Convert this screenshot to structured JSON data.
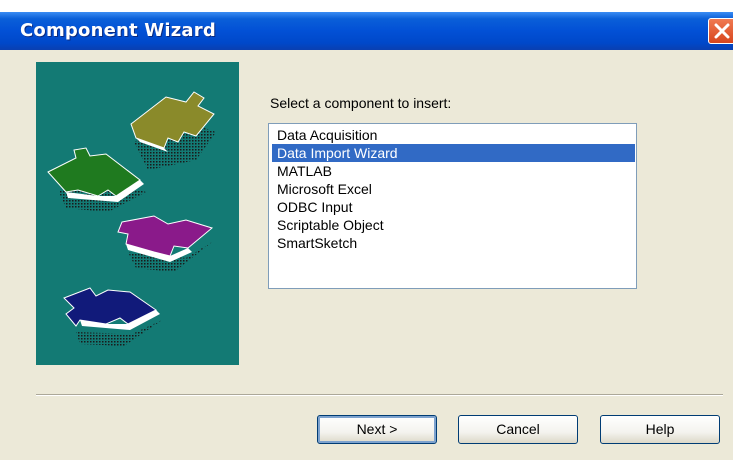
{
  "window": {
    "title": "Component Wizard"
  },
  "main": {
    "prompt": "Select a component to insert:",
    "components": [
      "Data Acquisition",
      "Data Import Wizard",
      "MATLAB",
      "Microsoft Excel",
      "ODBC Input",
      "Scriptable Object",
      "SmartSketch"
    ],
    "selected_component": "Data Import Wizard"
  },
  "buttons": {
    "next_label": "Next >",
    "cancel_label": "Cancel",
    "help_label": "Help"
  },
  "colors": {
    "title_bar": "#0250d6",
    "panel_background": "#137a74",
    "selection": "#316ac5"
  },
  "icons": {
    "close": "close-icon",
    "puzzle": "puzzle-piece-icon"
  }
}
